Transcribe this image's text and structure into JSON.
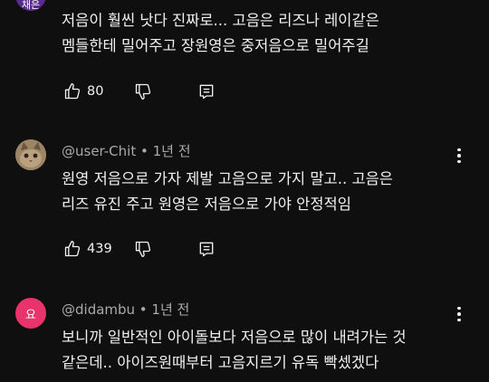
{
  "comments": [
    {
      "avatar_text": "채은",
      "avatar_color": "#5a2b8c",
      "meta": "",
      "lines": [
        "저음이 훨씬 낫다 진짜로... 고음은 리즈나 레이같은",
        "멤들한테 밀어주고 장원영은 중저음으로 밀어주길"
      ],
      "likes": "80"
    },
    {
      "avatar_text": "",
      "avatar_color": "#8a7050",
      "meta": "@user-Chit • 1년 전",
      "lines": [
        "원영 저음으로 가자 제발 고음으로 가지 말고.. 고음은",
        "리즈 유진 주고 원영은 저음으로 가야 안정적임"
      ],
      "likes": "439"
    },
    {
      "avatar_text": "요",
      "avatar_color": "#e8336d",
      "meta": "@didambu • 1년 전",
      "lines": [
        "보니까 일반적인 아이돌보다 저음으로 많이 내려가는 것",
        "같은데.. 아이즈원때부터 고음지르기 유독 빡셌겠다"
      ],
      "likes": ""
    }
  ],
  "icons": {
    "like": "thumb-up-icon",
    "dislike": "thumb-down-icon",
    "reply": "reply-comment-icon",
    "more": "more-vertical-icon"
  }
}
